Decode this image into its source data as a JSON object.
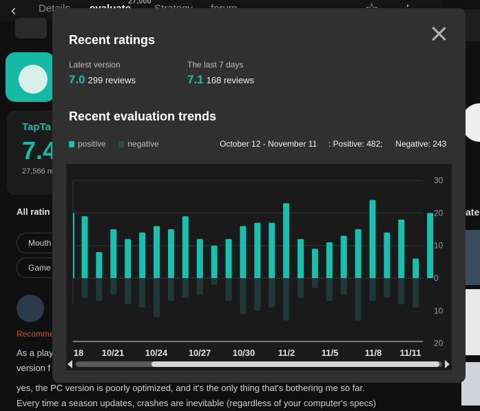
{
  "background": {
    "tabs": [
      "Details",
      "evaluate",
      "Strategy",
      "forum"
    ],
    "evaluate_count": "27,000",
    "taptap_logo": "TapTa",
    "score_partial": "7.4",
    "rating_count_partial": "27,566 re",
    "all_ratings_partial": "All ratin",
    "chips": [
      "Mouth",
      "Game c"
    ],
    "recommend_partial": "Recomme",
    "review_lines": [
      "As a play",
      "version f",
      "yes, the PC version is poorly optimized, and it's the only thing that's bothering me so far.",
      "Every time a season updates, crashes are inevitable (regardless of your computer's specs)"
    ],
    "right_label_partial": "ate"
  },
  "modal": {
    "recent_ratings_title": "Recent ratings",
    "latest_version_label": "Latest version",
    "latest_version_score": "7.0",
    "latest_version_reviews": "299 reviews",
    "last7_label": "The last 7 days",
    "last7_score": "7.1",
    "last7_reviews": "168 reviews",
    "trends_title": "Recent evaluation trends",
    "legend_positive": "positive",
    "legend_negative": "negative",
    "date_range": "October 12 - November 11",
    "positive_summary": ": Positive: 482;",
    "negative_summary": "Negative: 243"
  },
  "colors": {
    "positive": "#16c1ae",
    "negative": "#1f3a36",
    "accent": "#16c1ae"
  },
  "chart_data": {
    "type": "bar",
    "categories": [
      "10/18",
      "10/19",
      "10/20",
      "10/21",
      "10/22",
      "10/23",
      "10/24",
      "10/25",
      "10/26",
      "10/27",
      "10/28",
      "10/29",
      "10/30",
      "10/31",
      "11/1",
      "11/2",
      "11/3",
      "11/4",
      "11/5",
      "11/6",
      "11/7",
      "11/8",
      "11/9",
      "11/10",
      "11/11"
    ],
    "series": [
      {
        "name": "positive",
        "values": [
          19,
          8,
          15,
          12,
          14,
          16,
          15,
          19,
          12,
          10,
          12,
          16,
          17,
          17,
          23,
          12,
          9,
          11,
          13,
          15,
          24,
          14,
          18,
          6,
          20
        ]
      },
      {
        "name": "negative",
        "values": [
          6,
          7,
          5,
          8,
          9,
          12,
          7,
          6,
          5,
          2,
          7,
          11,
          10,
          9,
          13,
          6,
          3,
          7,
          5,
          13,
          7,
          6,
          8,
          9,
          0
        ]
      }
    ],
    "leading_partial_value": 20,
    "x_tick_labels": [
      "18",
      "10/21",
      "10/24",
      "10/27",
      "10/30",
      "11/2",
      "11/5",
      "11/8",
      "11/11"
    ],
    "y_ticks_positive": [
      30,
      20,
      10,
      0
    ],
    "y_ticks_negative": [
      10,
      20
    ],
    "ylim_positive": [
      0,
      30
    ],
    "ylim_negative": [
      0,
      20
    ],
    "grid": true,
    "legend": "top-left"
  }
}
